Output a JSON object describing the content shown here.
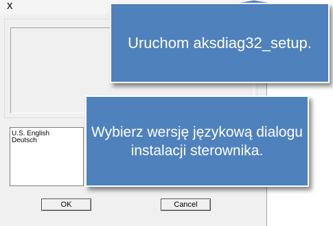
{
  "dialog": {
    "close_glyph": "x",
    "languages": [
      "U.S. English",
      "Deutsch"
    ],
    "ok_label": "OK",
    "cancel_label": "Cancel"
  },
  "callouts": {
    "run_setup": "Uruchom aksdiag32_setup.",
    "choose_language": "Wybierz wersję językową dialogu instalacji sterownika."
  },
  "colors": {
    "callout_fill": "#4f81bd",
    "dialog_bg": "#f0f0f0"
  }
}
